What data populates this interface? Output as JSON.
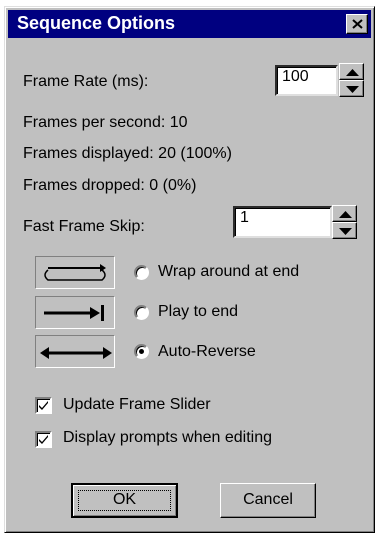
{
  "window": {
    "title": "Sequence Options",
    "close_glyph": "×"
  },
  "frame_rate": {
    "label": "Frame Rate (ms):",
    "value": "100"
  },
  "stats": {
    "fps": "Frames per second: 10",
    "displayed": "Frames displayed: 20 (100%)",
    "dropped": "Frames dropped: 0 (0%)"
  },
  "fast_frame_skip": {
    "label": "Fast Frame Skip:",
    "value": "1"
  },
  "playback_modes": [
    {
      "label": "Wrap around at end",
      "icon": "wrap-around-icon",
      "selected": false
    },
    {
      "label": "Play to end",
      "icon": "play-to-end-icon",
      "selected": false
    },
    {
      "label": "Auto-Reverse",
      "icon": "auto-reverse-icon",
      "selected": true
    }
  ],
  "options": [
    {
      "label": "Update Frame Slider",
      "checked": true
    },
    {
      "label": "Display prompts when editing",
      "checked": true
    }
  ],
  "buttons": {
    "ok": "OK",
    "cancel": "Cancel"
  },
  "colors": {
    "title_bar": "#000080",
    "dialog_face": "#c0c0c0"
  }
}
